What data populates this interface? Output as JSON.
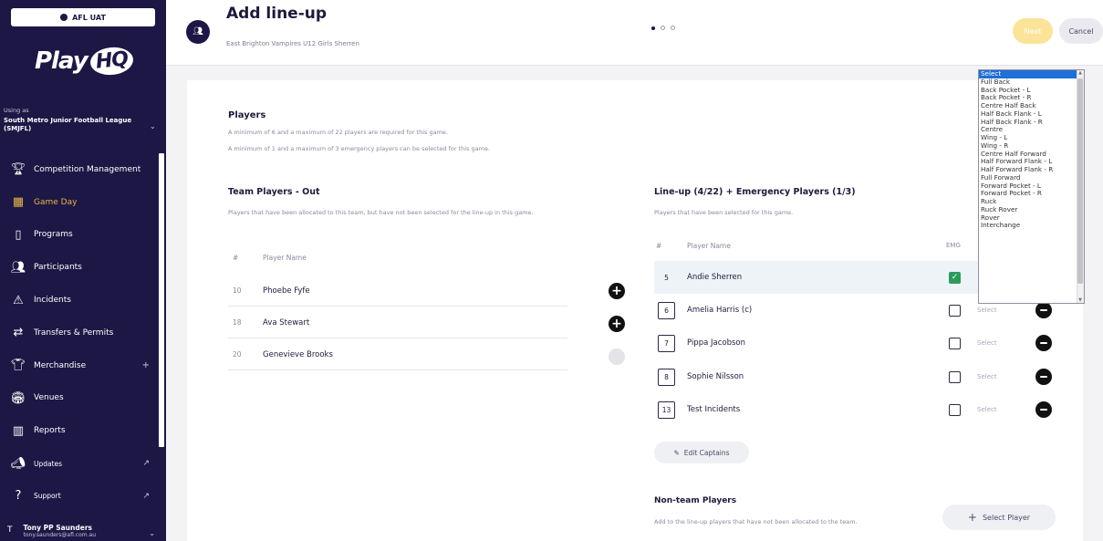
{
  "env": {
    "label": "AFL UAT"
  },
  "brand": {
    "logo_text": "Play",
    "logo_badge": "HQ"
  },
  "org": {
    "using_label": "Using as",
    "name": "South Metro Junior Football League (SMJFL)"
  },
  "nav": {
    "items": [
      {
        "label": "Competition Management",
        "icon": "trophy-icon"
      },
      {
        "label": "Game Day",
        "icon": "scoreboard-icon",
        "active": true
      },
      {
        "label": "Programs",
        "icon": "book-icon"
      },
      {
        "label": "Participants",
        "icon": "people-icon"
      },
      {
        "label": "Incidents",
        "icon": "warning-icon"
      },
      {
        "label": "Transfers & Permits",
        "icon": "transfer-icon"
      },
      {
        "label": "Merchandise",
        "icon": "shirt-icon",
        "expand": "+"
      },
      {
        "label": "Venues",
        "icon": "stadium-icon"
      },
      {
        "label": "Reports",
        "icon": "reports-icon"
      },
      {
        "label": "Updates",
        "icon": "updates-icon"
      },
      {
        "label": "Support",
        "icon": "help-icon"
      }
    ],
    "user": {
      "name": "Tony PP Saunders",
      "email": "tony.saunders@afl.com.au"
    }
  },
  "header": {
    "title": "Add line-up",
    "subtitle": "East Brighton Vampires U12 Girls Sherren",
    "next_label": "Next",
    "cancel_label": "Cancel"
  },
  "players_section": {
    "title": "Players",
    "note1": "A minimum of 6 and a maximum of 22 players are required for this game.",
    "note2": "A minimum of 1 and a maximum of 3 emergency players can be selected for this game."
  },
  "out_section": {
    "title": "Team Players - Out",
    "note": "Players that have been allocated to this team, but have not been selected for the line-up in this game.",
    "col_num": "#",
    "col_name": "Player Name",
    "rows": [
      {
        "num": "10",
        "name": "Phoebe Fyfe"
      },
      {
        "num": "18",
        "name": "Ava Stewart"
      },
      {
        "num": "20",
        "name": "Genevieve Brooks"
      }
    ]
  },
  "lineup_section": {
    "title": "Line-up (4/22) + Emergency Players (1/3)",
    "note": "Players that have been selected for this game.",
    "col_num": "#",
    "col_name": "Player Name",
    "col_emg": "EMG",
    "position_placeholder": "Select",
    "rows": [
      {
        "num": "5",
        "name": "Andie Sherren",
        "emg": true
      },
      {
        "num": "6",
        "name": "Amelia Harris (c)",
        "emg": false
      },
      {
        "num": "7",
        "name": "Pippa Jacobson",
        "emg": false
      },
      {
        "num": "8",
        "name": "Sophie Nilsson",
        "emg": false
      },
      {
        "num": "13",
        "name": "Test Incidents",
        "emg": false
      }
    ],
    "edit_captains_label": "Edit Captains"
  },
  "nonteam_section": {
    "title": "Non-team Players",
    "note": "Add to the line-up players that have not been allocated to the team.",
    "select_label": "Select Player"
  },
  "position_dropdown": {
    "options": [
      "Select",
      "Full Back",
      "Back Pocket - L",
      "Back Pocket - R",
      "Centre Half Back",
      "Half Back Flank - L",
      "Half Back Flank - R",
      "Centre",
      "Wing - L",
      "Wing - R",
      "Centre Half Forward",
      "Half Forward Flank - L",
      "Half Forward Flank - R",
      "Full Forward",
      "Forward Pocket - L",
      "Forward Pocket - R",
      "Ruck",
      "Ruck Rover",
      "Rover",
      "Interchange"
    ],
    "selected": "Select"
  },
  "colors": {
    "sidebar_bg": "#1d1745",
    "active_nav": "#e6b84a",
    "next_button": "#fbe49a",
    "emg_checked": "#2e9a5e",
    "dropdown_highlight": "#1e6fd9"
  }
}
